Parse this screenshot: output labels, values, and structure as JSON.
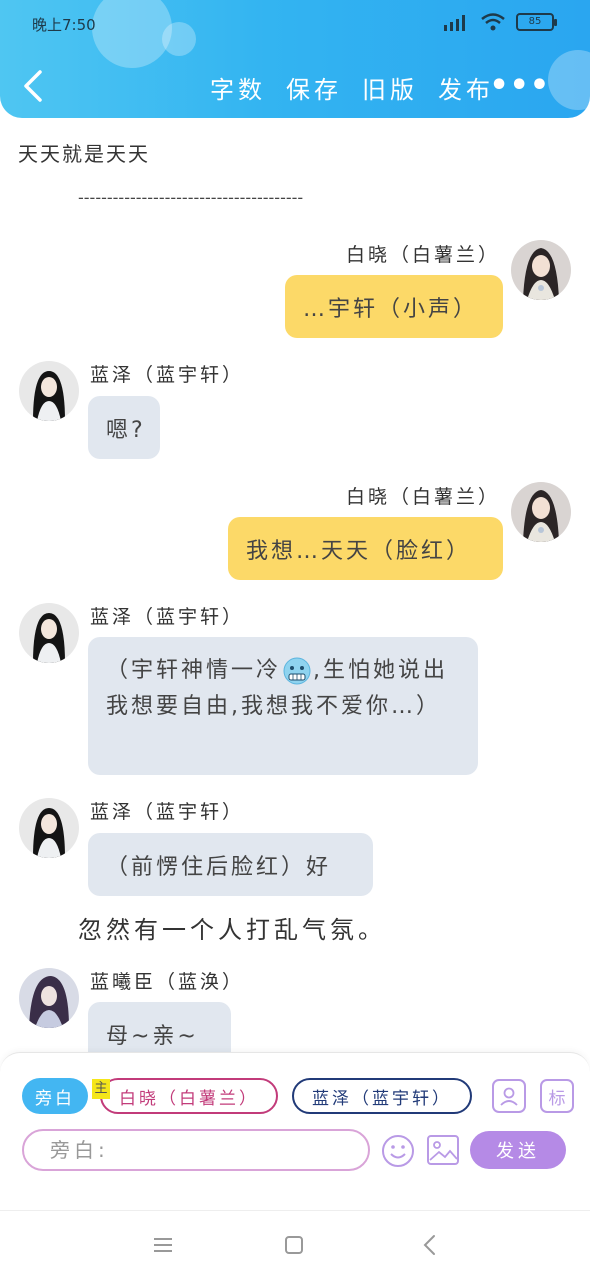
{
  "status_bar": {
    "time": "晚上7:50",
    "battery": "85"
  },
  "header": {
    "actions": [
      "字数",
      "保存",
      "旧版",
      "发布"
    ],
    "more": "•••"
  },
  "page": {
    "title": "天天就是天天",
    "divider": "---------------------------------------"
  },
  "messages": [
    {
      "side": "right",
      "name": "白晓（白薯兰）",
      "text": "…宇轩（小声）"
    },
    {
      "side": "left",
      "name": "蓝泽（蓝宇轩）",
      "text": "嗯?"
    },
    {
      "side": "right",
      "name": "白晓（白薯兰）",
      "text": "我想…天天（脸红）"
    },
    {
      "side": "left",
      "name": "蓝泽（蓝宇轩）",
      "text_before_emoji": "（宇轩神情一冷",
      "text_after_emoji": ",生怕她说出我想要自由,我想我不爱你…）",
      "emoji": "cold-face"
    },
    {
      "side": "left",
      "name": "蓝泽（蓝宇轩）",
      "text": "（前愣住后脸红）好"
    },
    {
      "side": "left",
      "name": "蓝曦臣（蓝涣）",
      "text": "母~亲~"
    }
  ],
  "narration": "忽然有一个人打乱气氛。",
  "composer": {
    "chips": {
      "narrator": "旁白",
      "main_tag": "主",
      "char1": "白晓（白薯兰）",
      "char2": "蓝泽（蓝宇轩）"
    },
    "tag_button": "标",
    "input_placeholder": "旁白:",
    "send_label": "发送"
  },
  "colors": {
    "header_gradient_start": "#4fc6f2",
    "header_gradient_end": "#2aa6f0",
    "right_bubble": "#fcd968",
    "left_bubble": "#e1e7ef",
    "send_button": "#b58ae6"
  }
}
